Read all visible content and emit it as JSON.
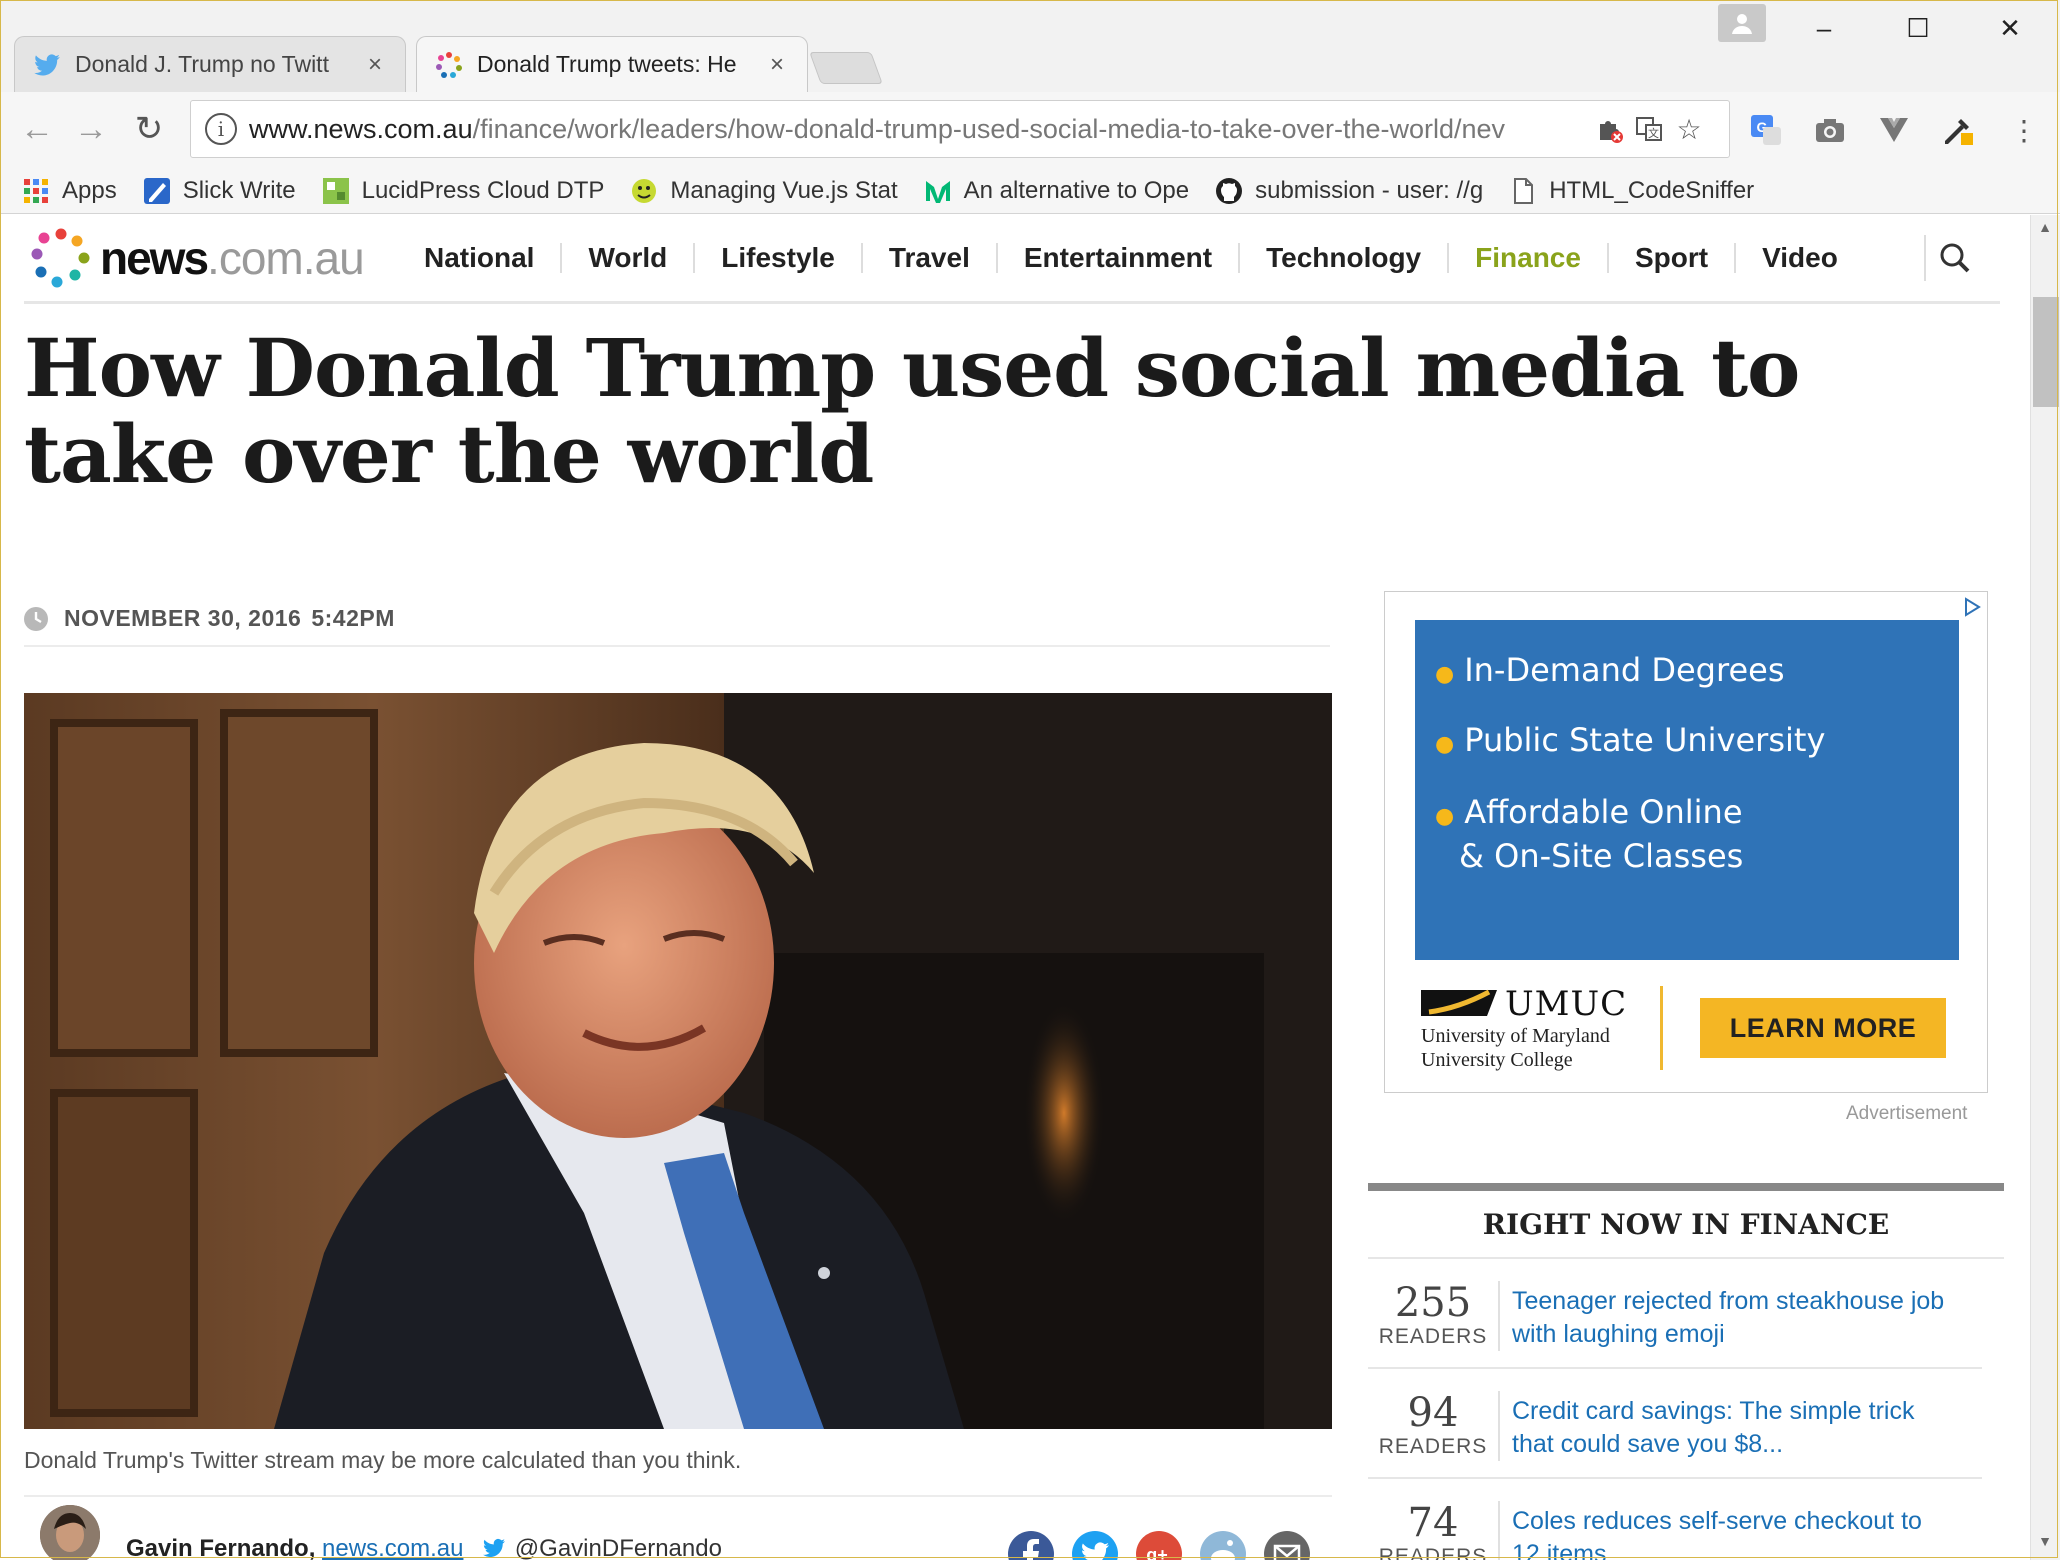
{
  "browser": {
    "tabs": [
      {
        "title": "Donald J. Trump no Twitt",
        "icon": "twitter-bird-icon"
      },
      {
        "title": "Donald Trump tweets: He",
        "icon": "news-dots-icon"
      }
    ],
    "url_host": "www.news.com.au",
    "url_path": "/finance/work/leaders/how-donald-trump-used-social-media-to-take-over-the-world/nev",
    "bookmarks": [
      {
        "label": "Apps",
        "icon": "apps-grid-icon"
      },
      {
        "label": "Slick Write",
        "icon": "slick-write-icon"
      },
      {
        "label": "LucidPress Cloud DTP",
        "icon": "lucidpress-icon"
      },
      {
        "label": "Managing Vue.js Stat",
        "icon": "vue-icon"
      },
      {
        "label": "An alternative to Ope",
        "icon": "medium-icon"
      },
      {
        "label": "submission - user: //g",
        "icon": "github-icon"
      },
      {
        "label": "HTML_CodeSniffer",
        "icon": "page-icon"
      }
    ]
  },
  "site": {
    "logo_main": "news",
    "logo_domain": ".com.au",
    "nav": [
      "National",
      "World",
      "Lifestyle",
      "Travel",
      "Entertainment",
      "Technology",
      "Finance",
      "Sport",
      "Video"
    ],
    "active_nav": "Finance"
  },
  "article": {
    "headline": "How Donald Trump used social media to take over the world",
    "date": "NOVEMBER 30, 2016",
    "time": "5:42PM",
    "caption": "Donald Trump's Twitter stream may be more calculated than you think.",
    "author": "Gavin Fernando,",
    "source": "news.com.au",
    "twitter_handle": "@GavinDFernando"
  },
  "ad": {
    "items": [
      "In-Demand Degrees",
      "Public State University",
      "Affordable Online",
      "& On-Site Classes"
    ],
    "brand": "UMUC",
    "brand_sub_1": "University of Maryland",
    "brand_sub_2": "University College",
    "cta": "LEARN MORE",
    "label": "Advertisement"
  },
  "right_now": {
    "title": "RIGHT NOW IN FINANCE",
    "readers_label": "READERS",
    "items": [
      {
        "count": "255",
        "title": "Teenager rejected from steakhouse job with laughing emoji"
      },
      {
        "count": "94",
        "title": "Credit card savings: The simple trick that could save you $8..."
      },
      {
        "count": "74",
        "title": "Coles reduces self-serve checkout to 12 items"
      }
    ]
  },
  "colors": {
    "finance_accent": "#8aa31b",
    "link_blue": "#1a6fb5",
    "ad_blue": "#2f73b7",
    "ad_cta": "#f4b624"
  }
}
